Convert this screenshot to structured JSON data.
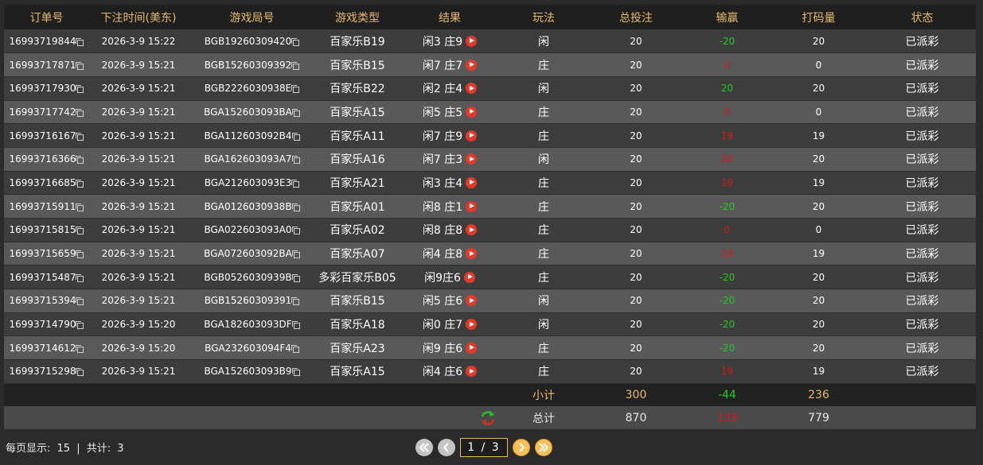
{
  "table": {
    "headers": [
      "订单号",
      "下注时间(美东)",
      "游戏局号",
      "游戏类型",
      "结果",
      "玩法",
      "总投注",
      "输赢",
      "打码量",
      "状态"
    ],
    "rows": [
      {
        "order": "16993719844",
        "time": "2026-3-9 15:22",
        "round": "BGB19260309420",
        "game": "百家乐B19",
        "result": "闲3 庄9",
        "play": "闲",
        "bet": "20",
        "win": "-20",
        "win_type": "pos",
        "code": "20",
        "status": "已派彩"
      },
      {
        "order": "16993717871",
        "time": "2026-3-9 15:21",
        "round": "BGB15260309392",
        "game": "百家乐B15",
        "result": "闲7 庄7",
        "play": "庄",
        "bet": "20",
        "win": "0",
        "win_type": "zero",
        "code": "0",
        "status": "已派彩"
      },
      {
        "order": "16993717930",
        "time": "2026-3-9 15:21",
        "round": "BGB2226030938E",
        "game": "百家乐B22",
        "result": "闲2 庄4",
        "play": "闲",
        "bet": "20",
        "win": "20",
        "win_type": "pos",
        "code": "20",
        "status": "已派彩"
      },
      {
        "order": "16993717742",
        "time": "2026-3-9 15:21",
        "round": "BGA152603093BA",
        "game": "百家乐A15",
        "result": "闲5 庄5",
        "play": "庄",
        "bet": "20",
        "win": "0",
        "win_type": "zero",
        "code": "0",
        "status": "已派彩"
      },
      {
        "order": "16993716167",
        "time": "2026-3-9 15:21",
        "round": "BGA112603092B4",
        "game": "百家乐A11",
        "result": "闲7 庄9",
        "play": "庄",
        "bet": "20",
        "win": "19",
        "win_type": "neg",
        "code": "19",
        "status": "已派彩"
      },
      {
        "order": "16993716366",
        "time": "2026-3-9 15:21",
        "round": "BGA162603093A7",
        "game": "百家乐A16",
        "result": "闲7 庄3",
        "play": "闲",
        "bet": "20",
        "win": "20",
        "win_type": "neg",
        "code": "20",
        "status": "已派彩"
      },
      {
        "order": "16993716685",
        "time": "2026-3-9 15:21",
        "round": "BGA212603093E3",
        "game": "百家乐A21",
        "result": "闲3 庄4",
        "play": "庄",
        "bet": "20",
        "win": "19",
        "win_type": "neg",
        "code": "19",
        "status": "已派彩"
      },
      {
        "order": "16993715911",
        "time": "2026-3-9 15:21",
        "round": "BGA0126030938B",
        "game": "百家乐A01",
        "result": "闲8 庄1",
        "play": "庄",
        "bet": "20",
        "win": "-20",
        "win_type": "pos",
        "code": "20",
        "status": "已派彩"
      },
      {
        "order": "16993715815",
        "time": "2026-3-9 15:21",
        "round": "BGA022603093A0",
        "game": "百家乐A02",
        "result": "闲8 庄8",
        "play": "庄",
        "bet": "20",
        "win": "0",
        "win_type": "zero",
        "code": "0",
        "status": "已派彩"
      },
      {
        "order": "16993715659",
        "time": "2026-3-9 15:21",
        "round": "BGA072603092BA",
        "game": "百家乐A07",
        "result": "闲4 庄8",
        "play": "庄",
        "bet": "20",
        "win": "19",
        "win_type": "neg",
        "code": "19",
        "status": "已派彩"
      },
      {
        "order": "16993715487",
        "time": "2026-3-9 15:21",
        "round": "BGB0526030939B",
        "game": "多彩百家乐B05",
        "result": "闲9庄6",
        "play": "庄",
        "bet": "20",
        "win": "-20",
        "win_type": "pos",
        "code": "20",
        "status": "已派彩"
      },
      {
        "order": "16993715394",
        "time": "2026-3-9 15:21",
        "round": "BGB15260309391",
        "game": "百家乐B15",
        "result": "闲5 庄6",
        "play": "闲",
        "bet": "20",
        "win": "-20",
        "win_type": "pos",
        "code": "20",
        "status": "已派彩"
      },
      {
        "order": "16993714790",
        "time": "2026-3-9 15:20",
        "round": "BGA182603093DF",
        "game": "百家乐A18",
        "result": "闲0 庄7",
        "play": "闲",
        "bet": "20",
        "win": "-20",
        "win_type": "pos",
        "code": "20",
        "status": "已派彩"
      },
      {
        "order": "16993714612",
        "time": "2026-3-9 15:20",
        "round": "BGA232603094F4",
        "game": "百家乐A23",
        "result": "闲9 庄6",
        "play": "庄",
        "bet": "20",
        "win": "-20",
        "win_type": "pos",
        "code": "20",
        "status": "已派彩"
      },
      {
        "order": "16993715298",
        "time": "2026-3-9 15:21",
        "round": "BGA152603093B9",
        "game": "百家乐A15",
        "result": "闲4 庄6",
        "play": "庄",
        "bet": "20",
        "win": "19",
        "win_type": "neg",
        "code": "19",
        "status": "已派彩"
      }
    ],
    "subtotal": {
      "label": "小计",
      "bet": "300",
      "win": "-44",
      "code": "236"
    },
    "total": {
      "label": "总计",
      "bet": "870",
      "win": "139",
      "code": "779"
    }
  },
  "footer": {
    "per_page_label": "每页显示:",
    "per_page_value": "15",
    "separator": "|",
    "total_label": "共计:",
    "total_value": "3",
    "page_display": "1 / 3"
  },
  "colors": {
    "header_text": "#e9b96a",
    "positive_win": "#22cc22",
    "negative_win": "#d41c1c",
    "play_icon": "#e53a2a",
    "pager_active": "#f5c05a"
  },
  "icons": {
    "copy": "copy-icon",
    "play": "play-icon",
    "refresh": "refresh-icon",
    "first_page": "double-chevron-left-icon",
    "prev_page": "chevron-left-icon",
    "next_page": "chevron-right-icon",
    "last_page": "double-chevron-right-icon"
  }
}
